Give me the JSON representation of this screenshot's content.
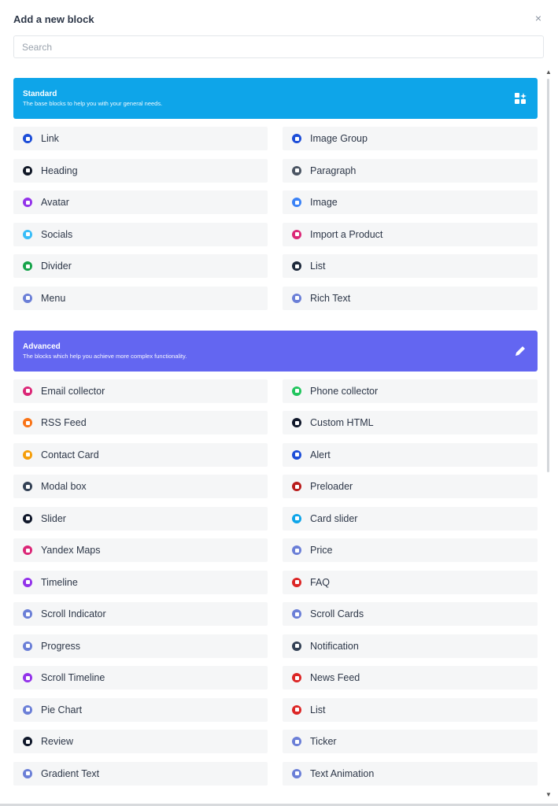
{
  "header": {
    "title": "Add a new block",
    "close_glyph": "×"
  },
  "search": {
    "placeholder": "Search",
    "value": ""
  },
  "categories": [
    {
      "id": "standard",
      "title": "Standard",
      "description": "The base blocks to help you with your general needs.",
      "color": "#0ea5e9",
      "icon": "grid-sparkle-icon",
      "blocks": [
        {
          "label": "Link",
          "icon": "link-icon",
          "color": "#1d4ed8"
        },
        {
          "label": "Image Group",
          "icon": "link-icon",
          "color": "#1d4ed8"
        },
        {
          "label": "Heading",
          "icon": "heading-icon",
          "color": "#111827"
        },
        {
          "label": "Paragraph",
          "icon": "paragraph-icon",
          "color": "#4b5563"
        },
        {
          "label": "Avatar",
          "icon": "avatar-icon",
          "color": "#9333ea"
        },
        {
          "label": "Image",
          "icon": "image-icon",
          "color": "#3b82f6"
        },
        {
          "label": "Socials",
          "icon": "socials-icon",
          "color": "#38bdf8"
        },
        {
          "label": "Import a Product",
          "icon": "product-icon",
          "color": "#db2777"
        },
        {
          "label": "Divider",
          "icon": "divider-icon",
          "color": "#16a34a"
        },
        {
          "label": "List",
          "icon": "list-icon",
          "color": "#1e293b"
        },
        {
          "label": "Menu",
          "icon": "menu-icon",
          "color": "#6b7fd7"
        },
        {
          "label": "Rich Text",
          "icon": "rich-text-icon",
          "color": "#6b7fd7"
        }
      ]
    },
    {
      "id": "advanced",
      "title": "Advanced",
      "description": "The blocks which help you achieve more complex functionality.",
      "color": "#6366f1",
      "icon": "pencil-icon",
      "blocks": [
        {
          "label": "Email collector",
          "icon": "email-icon",
          "color": "#db2777"
        },
        {
          "label": "Phone collector",
          "icon": "phone-icon",
          "color": "#22c55e"
        },
        {
          "label": "RSS Feed",
          "icon": "rss-icon",
          "color": "#f97316"
        },
        {
          "label": "Custom HTML",
          "icon": "code-icon",
          "color": "#0f172a"
        },
        {
          "label": "Contact Card",
          "icon": "contact-card-icon",
          "color": "#f59e0b"
        },
        {
          "label": "Alert",
          "icon": "alert-icon",
          "color": "#1d4ed8"
        },
        {
          "label": "Modal box",
          "icon": "modal-icon",
          "color": "#334155"
        },
        {
          "label": "Preloader",
          "icon": "preloader-icon",
          "color": "#b91c1c"
        },
        {
          "label": "Slider",
          "icon": "slider-icon",
          "color": "#0f172a"
        },
        {
          "label": "Card slider",
          "icon": "card-slider-icon",
          "color": "#0ea5e9"
        },
        {
          "label": "Yandex Maps",
          "icon": "map-icon",
          "color": "#db2777"
        },
        {
          "label": "Price",
          "icon": "price-icon",
          "color": "#6b7fd7"
        },
        {
          "label": "Timeline",
          "icon": "timeline-icon",
          "color": "#9333ea"
        },
        {
          "label": "FAQ",
          "icon": "faq-icon",
          "color": "#dc2626"
        },
        {
          "label": "Scroll Indicator",
          "icon": "scroll-indicator-icon",
          "color": "#6b7fd7"
        },
        {
          "label": "Scroll Cards",
          "icon": "scroll-cards-icon",
          "color": "#6b7fd7"
        },
        {
          "label": "Progress",
          "icon": "progress-icon",
          "color": "#6b7fd7"
        },
        {
          "label": "Notification",
          "icon": "notification-icon",
          "color": "#334155"
        },
        {
          "label": "Scroll Timeline",
          "icon": "scroll-timeline-icon",
          "color": "#9333ea"
        },
        {
          "label": "News Feed",
          "icon": "news-feed-icon",
          "color": "#dc2626"
        },
        {
          "label": "Pie Chart",
          "icon": "pie-chart-icon",
          "color": "#6b7fd7"
        },
        {
          "label": "List",
          "icon": "list-icon",
          "color": "#dc2626"
        },
        {
          "label": "Review",
          "icon": "review-icon",
          "color": "#0f172a"
        },
        {
          "label": "Ticker",
          "icon": "ticker-icon",
          "color": "#6b7fd7"
        },
        {
          "label": "Gradient Text",
          "icon": "gradient-text-icon",
          "color": "#6b7fd7"
        },
        {
          "label": "Text Animation",
          "icon": "text-animation-icon",
          "color": "#6b7fd7"
        }
      ]
    }
  ]
}
